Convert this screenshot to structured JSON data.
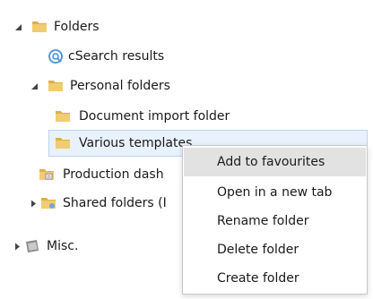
{
  "tree": {
    "folders_label": "Folders",
    "csearch_label": "cSearch results",
    "personal_label": "Personal folders",
    "doc_import_label": "Document import folder",
    "various_label": "Various templates",
    "production_label": "Production dash",
    "shared_label": "Shared folders (I",
    "misc_label": "Misc."
  },
  "context_menu": {
    "add_favourites": "Add to favourites",
    "open_new_tab": "Open in a new tab",
    "rename_folder": "Rename folder",
    "delete_folder": "Delete folder",
    "create_folder": "Create folder"
  },
  "colors": {
    "folder_yellow": "#e8c566",
    "selection_bg": "#e9f2fc",
    "menu_highlight": "#e2e2e2",
    "search_blue": "#4a8fd0"
  }
}
